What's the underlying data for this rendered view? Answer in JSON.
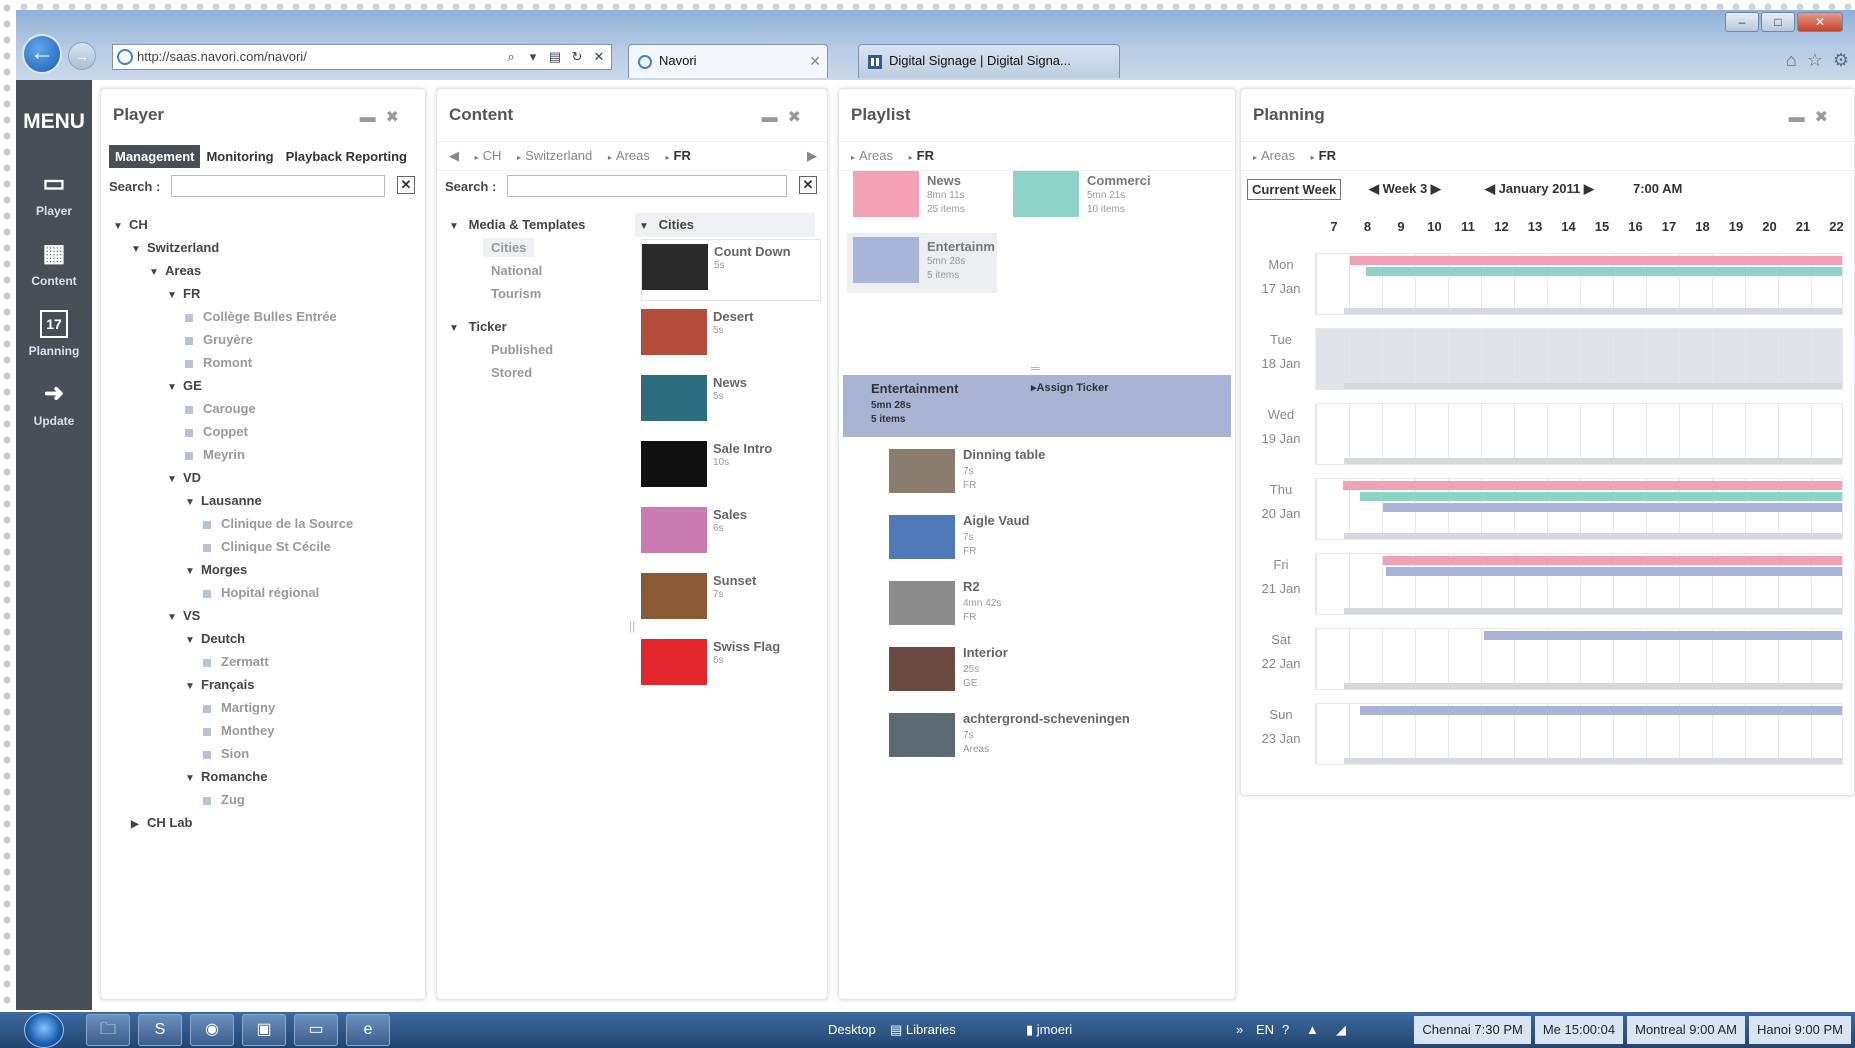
{
  "browser": {
    "url": "http://saas.navori.com/navori/",
    "tabs": [
      {
        "label": "Navori"
      },
      {
        "label": "Digital Signage | Digital Signa..."
      }
    ]
  },
  "menu": {
    "title": "MENU",
    "items": [
      {
        "label": "Player",
        "icon": "monitor-icon"
      },
      {
        "label": "Content",
        "icon": "film-icon"
      },
      {
        "label": "Planning",
        "icon": "calendar-icon",
        "icon_text": "17"
      },
      {
        "label": "Update",
        "icon": "arrow-right-icon"
      }
    ]
  },
  "player": {
    "title": "Player",
    "tabs": [
      "Management",
      "Monitoring",
      "Playback Reporting"
    ],
    "search_label": "Search :",
    "tree": [
      {
        "label": "CH",
        "level": 0,
        "type": "open"
      },
      {
        "label": "Switzerland",
        "level": 1,
        "type": "open"
      },
      {
        "label": "Areas",
        "level": 2,
        "type": "open"
      },
      {
        "label": "FR",
        "level": 3,
        "type": "open"
      },
      {
        "label": "Collège Bulles Entrée",
        "level": 4,
        "type": "leaf"
      },
      {
        "label": "Gruyère",
        "level": 4,
        "type": "leaf"
      },
      {
        "label": "Romont",
        "level": 4,
        "type": "leaf"
      },
      {
        "label": "GE",
        "level": 3,
        "type": "open"
      },
      {
        "label": "Carouge",
        "level": 4,
        "type": "leaf"
      },
      {
        "label": "Coppet",
        "level": 4,
        "type": "leaf"
      },
      {
        "label": "Meyrin",
        "level": 4,
        "type": "leaf"
      },
      {
        "label": "VD",
        "level": 3,
        "type": "open"
      },
      {
        "label": "Lausanne",
        "level": 4,
        "type": "open"
      },
      {
        "label": "Clinique de la Source",
        "level": 5,
        "type": "leaf"
      },
      {
        "label": "Clinique St Cécile",
        "level": 5,
        "type": "leaf"
      },
      {
        "label": "Morges",
        "level": 4,
        "type": "open"
      },
      {
        "label": "Hopital régional",
        "level": 5,
        "type": "leaf"
      },
      {
        "label": "VS",
        "level": 3,
        "type": "open"
      },
      {
        "label": "Deutch",
        "level": 4,
        "type": "open"
      },
      {
        "label": "Zermatt",
        "level": 5,
        "type": "leaf"
      },
      {
        "label": "Français",
        "level": 4,
        "type": "open"
      },
      {
        "label": "Martigny",
        "level": 5,
        "type": "leaf"
      },
      {
        "label": "Monthey",
        "level": 5,
        "type": "leaf"
      },
      {
        "label": "Sion",
        "level": 5,
        "type": "leaf"
      },
      {
        "label": "Romanche",
        "level": 4,
        "type": "open"
      },
      {
        "label": "Zug",
        "level": 5,
        "type": "leaf"
      },
      {
        "label": "CH Lab",
        "level": 1,
        "type": "closed"
      }
    ]
  },
  "content": {
    "title": "Content",
    "breadcrumb": [
      "CH",
      "Switzerland",
      "Areas",
      "FR"
    ],
    "search_label": "Search :",
    "categories": [
      {
        "label": "Media & Templates",
        "children": [
          "Cities",
          "National",
          "Tourism"
        ]
      },
      {
        "label": "Ticker",
        "children": [
          "Published",
          "Stored"
        ]
      }
    ],
    "folder": "Cities",
    "media": [
      {
        "name": "Count Down",
        "duration": "5s",
        "thumb": "#2b2b2b"
      },
      {
        "name": "Desert",
        "duration": "5s",
        "thumb": "#b44c3a"
      },
      {
        "name": "News",
        "duration": "5s",
        "thumb": "#2e6d7e"
      },
      {
        "name": "Sale Intro",
        "duration": "10s",
        "thumb": "#111111"
      },
      {
        "name": "Sales",
        "duration": "6s",
        "thumb": "#c97bb2"
      },
      {
        "name": "Sunset",
        "duration": "7s",
        "thumb": "#8a5a34"
      },
      {
        "name": "Swiss Flag",
        "duration": "6s",
        "thumb": "#e2262b"
      }
    ]
  },
  "playlist": {
    "title": "Playlist",
    "breadcrumb": [
      "Areas",
      "FR"
    ],
    "tiles": [
      {
        "name": "News",
        "length": "8mn 11s",
        "count": "25 items",
        "color": "#f4a1b5"
      },
      {
        "name": "Commerci",
        "length": "5mn 21s",
        "count": "10 items",
        "color": "#8fd3c7"
      },
      {
        "name": "Entertainm",
        "length": "5mn 28s",
        "count": "5 items",
        "color": "#a9b4d9"
      }
    ],
    "selected": {
      "name": "Entertainment",
      "length": "5mn 28s",
      "count": "5 items",
      "action": "Assign Ticker"
    },
    "items": [
      {
        "name": "Dinning table",
        "duration": "7s",
        "area": "FR",
        "thumb": "#8a7d70"
      },
      {
        "name": "Aigle Vaud",
        "duration": "7s",
        "area": "FR",
        "thumb": "#4f79b8"
      },
      {
        "name": "R2",
        "duration": "4mn 42s",
        "area": "FR",
        "thumb": "#8c8c8c"
      },
      {
        "name": "Interior",
        "duration": "25s",
        "area": "GE",
        "thumb": "#6b4a44"
      },
      {
        "name": "achtergrond-scheveningen",
        "duration": "7s",
        "area": "Areas",
        "thumb": "#5c6a74"
      }
    ]
  },
  "planning": {
    "title": "Planning",
    "breadcrumb": [
      "Areas",
      "FR"
    ],
    "current_week": "Current Week",
    "week": "Week 3",
    "month": "January 2011",
    "time": "7:00 AM",
    "hours": [
      "7",
      "8",
      "9",
      "10",
      "11",
      "12",
      "13",
      "14",
      "15",
      "16",
      "17",
      "18",
      "19",
      "20",
      "21",
      "22"
    ],
    "days": [
      {
        "day": "Mon",
        "date": "17 Jan",
        "bars": [
          {
            "color": "#f2a0b6",
            "start": 7.5,
            "end": 22.5
          },
          {
            "color": "#8fd3c7",
            "start": 8,
            "end": 22.5
          }
        ]
      },
      {
        "day": "Tue",
        "date": "18 Jan",
        "bars": [],
        "blocked": true
      },
      {
        "day": "Wed",
        "date": "19 Jan",
        "bars": []
      },
      {
        "day": "Thu",
        "date": "20 Jan",
        "bars": [
          {
            "color": "#f2a0b6",
            "start": 7.3,
            "end": 22.5
          },
          {
            "color": "#8fd3c7",
            "start": 7.8,
            "end": 22.5
          },
          {
            "color": "#a9b4d9",
            "start": 8.5,
            "end": 22.5
          }
        ]
      },
      {
        "day": "Fri",
        "date": "21 Jan",
        "bars": [
          {
            "color": "#f2a0b6",
            "start": 8.5,
            "end": 22.5
          },
          {
            "color": "#a9b4d9",
            "start": 8.6,
            "end": 22.5
          }
        ]
      },
      {
        "day": "Sat",
        "date": "22 Jan",
        "bars": [
          {
            "color": "#a9b4d9",
            "start": 11.5,
            "end": 22.5
          }
        ]
      },
      {
        "day": "Sun",
        "date": "23 Jan",
        "bars": [
          {
            "color": "#a9b4d9",
            "start": 7.8,
            "end": 22.5
          }
        ]
      }
    ]
  },
  "taskbar": {
    "desktop": "Desktop",
    "libraries": "Libraries",
    "user": "jmoeri",
    "lang": "EN",
    "clocks": [
      "Chennai 7:30 PM",
      "Me 15:00:04",
      "Montreal 9:00 AM",
      "Hanoi 9:00 PM"
    ]
  }
}
